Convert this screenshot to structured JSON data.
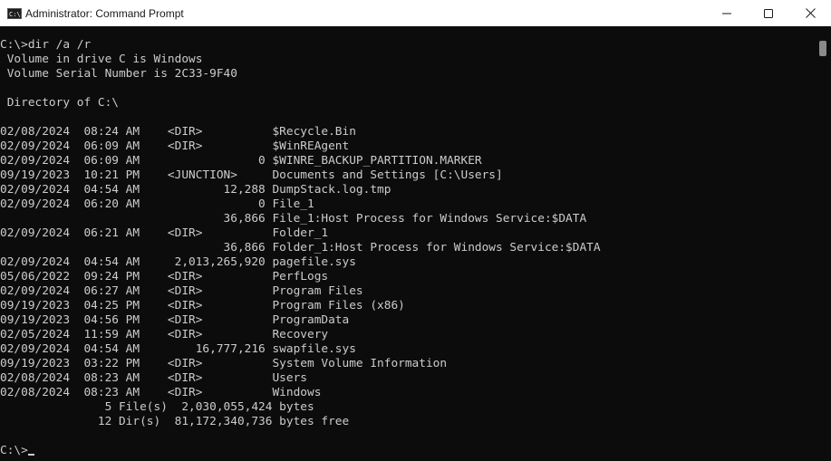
{
  "window": {
    "title": "Administrator: Command Prompt",
    "icon": "cmd-icon",
    "icon_glyph": "C:\\"
  },
  "controls": {
    "minimize": "minimize-icon",
    "maximize": "maximize-icon",
    "close": "close-icon"
  },
  "console": {
    "lines": [
      "C:\\>dir /a /r",
      " Volume in drive C is Windows",
      " Volume Serial Number is 2C33-9F40",
      "",
      " Directory of C:\\",
      "",
      "02/08/2024  08:24 AM    <DIR>          $Recycle.Bin",
      "02/09/2024  06:09 AM    <DIR>          $WinREAgent",
      "02/09/2024  06:09 AM                 0 $WINRE_BACKUP_PARTITION.MARKER",
      "09/19/2023  10:21 PM    <JUNCTION>     Documents and Settings [C:\\Users]",
      "02/09/2024  04:54 AM            12,288 DumpStack.log.tmp",
      "02/09/2024  06:20 AM                 0 File_1",
      "                                36,866 File_1:Host Process for Windows Service:$DATA",
      "02/09/2024  06:21 AM    <DIR>          Folder_1",
      "                                36,866 Folder_1:Host Process for Windows Service:$DATA",
      "02/09/2024  04:54 AM     2,013,265,920 pagefile.sys",
      "05/06/2022  09:24 PM    <DIR>          PerfLogs",
      "02/09/2024  06:27 AM    <DIR>          Program Files",
      "09/19/2023  04:25 PM    <DIR>          Program Files (x86)",
      "09/19/2023  04:56 PM    <DIR>          ProgramData",
      "02/05/2024  11:59 AM    <DIR>          Recovery",
      "02/09/2024  04:54 AM        16,777,216 swapfile.sys",
      "09/19/2023  03:22 PM    <DIR>          System Volume Information",
      "02/08/2024  08:23 AM    <DIR>          Users",
      "02/08/2024  08:23 AM    <DIR>          Windows",
      "               5 File(s)  2,030,055,424 bytes",
      "              12 Dir(s)  81,172,340,736 bytes free",
      "",
      "C:\\>"
    ]
  },
  "colors": {
    "console_bg": "#0c0c0c",
    "console_fg": "#cccccc",
    "titlebar_bg": "#ffffff",
    "scroll_thumb": "#8a8a8a"
  }
}
